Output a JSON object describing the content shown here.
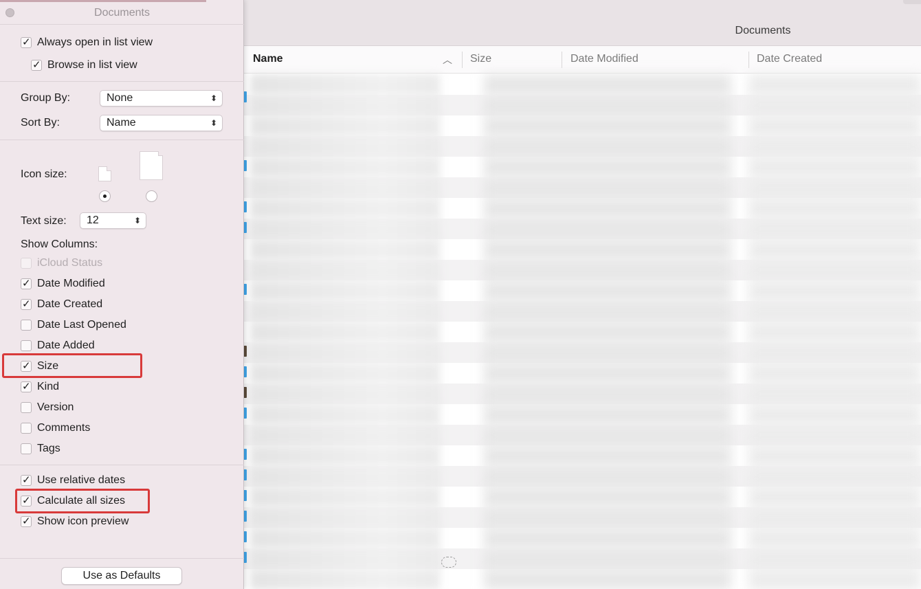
{
  "finder": {
    "title": "Documents",
    "columns": {
      "name": "Name",
      "size": "Size",
      "date_modified": "Date Modified",
      "date_created": "Date Created"
    }
  },
  "panel": {
    "title": "Documents",
    "always_open_list_view": {
      "label": "Always open in list view",
      "checked": true
    },
    "browse_list_view": {
      "label": "Browse in list view",
      "checked": true
    },
    "group_by": {
      "label": "Group By:",
      "value": "None"
    },
    "sort_by": {
      "label": "Sort By:",
      "value": "Name"
    },
    "icon_size": {
      "label": "Icon size:",
      "selected": "small"
    },
    "text_size": {
      "label": "Text size:",
      "value": "12"
    },
    "show_columns_label": "Show Columns:",
    "columns": [
      {
        "label": "iCloud Status",
        "checked": false,
        "disabled": true
      },
      {
        "label": "Date Modified",
        "checked": true
      },
      {
        "label": "Date Created",
        "checked": true
      },
      {
        "label": "Date Last Opened",
        "checked": false
      },
      {
        "label": "Date Added",
        "checked": false
      },
      {
        "label": "Size",
        "checked": true,
        "highlighted": true
      },
      {
        "label": "Kind",
        "checked": true
      },
      {
        "label": "Version",
        "checked": false
      },
      {
        "label": "Comments",
        "checked": false
      },
      {
        "label": "Tags",
        "checked": false
      }
    ],
    "options": [
      {
        "label": "Use relative dates",
        "checked": true
      },
      {
        "label": "Calculate all sizes",
        "checked": true,
        "highlighted": true
      },
      {
        "label": "Show icon preview",
        "checked": true
      }
    ],
    "defaults_button": "Use as Defaults"
  },
  "colors": {
    "highlight": "#d83a3a",
    "panel_bg": "#f0e7eb",
    "folder_accent": "#3fa3e6"
  }
}
